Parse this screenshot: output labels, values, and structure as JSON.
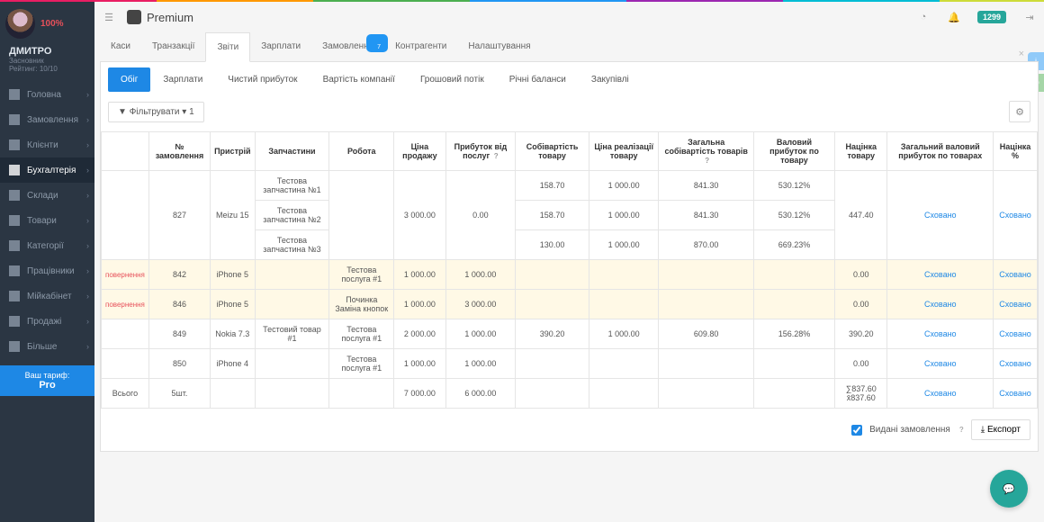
{
  "brand": "Premium",
  "user": {
    "name": "ДМИТРО",
    "role": "Засновник",
    "rating": "Рейтинг: 10/10",
    "pct": "100%"
  },
  "badge": "1299",
  "plan": {
    "lbl": "Ваш тариф:",
    "val": "Pro"
  },
  "sidebar": [
    {
      "l": "Головна",
      "i": "home-icon"
    },
    {
      "l": "Замовлення",
      "i": "orders-icon"
    },
    {
      "l": "Клієнти",
      "i": "clients-icon"
    },
    {
      "l": "Бухгалтерія",
      "i": "accounting-icon",
      "active": true
    },
    {
      "l": "Склади",
      "i": "warehouses-icon"
    },
    {
      "l": "Товари",
      "i": "products-icon"
    },
    {
      "l": "Категорії",
      "i": "categories-icon"
    },
    {
      "l": "Працівники",
      "i": "employees-icon"
    },
    {
      "l": "Мійкабінет",
      "i": "cabinet-icon"
    },
    {
      "l": "Продажі",
      "i": "sales-icon"
    },
    {
      "l": "Більше",
      "i": "more-icon"
    }
  ],
  "tabs": [
    "Каси",
    "Транзакції",
    "Звіти",
    "Зарплати",
    "Замовлення",
    "Контрагенти",
    "Налаштування"
  ],
  "tabs_active": 2,
  "tabs_bubble": {
    "index": 4,
    "val": "7"
  },
  "subtabs": [
    "Обіг",
    "Зарплати",
    "Чистий прибуток",
    "Вартість компанії",
    "Грошовий потік",
    "Річні баланси",
    "Закупівлі"
  ],
  "subtabs_active": 0,
  "filter_label": "Фільтрувати",
  "filter_bubble": "1",
  "columns": [
    "",
    "№ замовлення",
    "Пристрій",
    "Запчастини",
    "Робота",
    "Ціна продажу",
    "Прибуток від послуг",
    "Собівартість товару",
    "Ціна реалізації товару",
    "Загальна собівартість товарів",
    "Валовий прибуток по товару",
    "Націнка товару",
    "Загальний валовий прибуток по товарах",
    "Націнка %"
  ],
  "hidden": "Сховано",
  "returned": "повернення",
  "rows": {
    "r827": {
      "order": "827",
      "device": "Meizu 15",
      "parts": [
        "Тестова запчастина №1",
        "Тестова запчастина №2",
        "Тестова запчастина №3"
      ],
      "price": "3 000.00",
      "svc_profit": "0.00",
      "lines": [
        {
          "cost": "158.70",
          "sale": "1 000.00",
          "total_cost": "841.30",
          "gross": "530.12%"
        },
        {
          "cost": "158.70",
          "sale": "1 000.00",
          "total_cost": "841.30",
          "gross": "530.12%"
        },
        {
          "cost": "130.00",
          "sale": "1 000.00",
          "total_cost": "870.00",
          "gross": "669.23%"
        }
      ],
      "markup": "447.40"
    },
    "r842": {
      "order": "842",
      "device": "iPhone 5",
      "work": "Тестова послуга #1",
      "price": "1 000.00",
      "svc_profit": "1 000.00",
      "markup": "0.00"
    },
    "r846": {
      "order": "846",
      "device": "iPhone 5",
      "work": "Починка Заміна кнопок",
      "price": "1 000.00",
      "svc_profit": "3 000.00",
      "markup": "0.00"
    },
    "r849": {
      "order": "849",
      "device": "Nokia 7.3",
      "part": "Тестовий товар #1",
      "work": "Тестова послуга #1",
      "price": "2 000.00",
      "svc_profit": "1 000.00",
      "cost": "390.20",
      "sale": "1 000.00",
      "total_cost": "609.80",
      "gross": "156.28%",
      "markup": "390.20"
    },
    "r850": {
      "order": "850",
      "device": "iPhone 4",
      "work": "Тестова послуга #1",
      "price": "1 000.00",
      "svc_profit": "1 000.00",
      "markup": "0.00"
    },
    "total": {
      "label": "Всього",
      "qty": "5шт.",
      "price": "7 000.00",
      "svc_profit": "6 000.00",
      "markup_sum": "∑837.60",
      "markup_avg": "x̄837.60"
    }
  },
  "deleted_chk": "Видані замовлення",
  "export": "Експорт"
}
